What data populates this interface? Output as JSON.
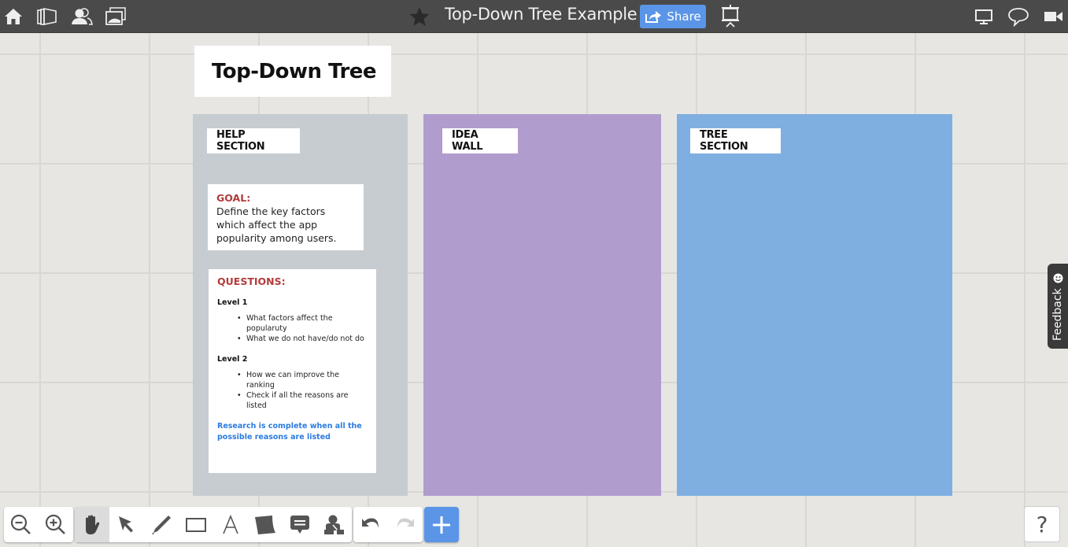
{
  "topbar": {
    "title": "Top-Down Tree Example",
    "share_label": "Share",
    "left_icons": [
      "home-icon",
      "boards-icon",
      "contacts-icon",
      "gallery-icon"
    ],
    "right_icons": [
      "screen-share-icon",
      "chat-icon",
      "video-icon"
    ],
    "favorite_icon": "star-icon",
    "present_icon": "presentation-icon"
  },
  "board": {
    "title": "Top-Down Tree",
    "sections": [
      {
        "label": "HELP SECTION",
        "color": "#c6ccd0"
      },
      {
        "label": "IDEA WALL",
        "color": "#b09ccd"
      },
      {
        "label": "TREE SECTION",
        "color": "#7fafe1"
      }
    ],
    "goal": {
      "heading": "GOAL:",
      "text": "Define the key factors which affect the app popularity among users."
    },
    "questions": {
      "heading": "QUESTIONS:",
      "levels": [
        {
          "title": "Level 1",
          "items": [
            "What factors affect the popularuty",
            "What we do not have/do not do"
          ]
        },
        {
          "title": "Level 2",
          "items": [
            "How we can improve the ranking",
            "Check if all the reasons are listed"
          ]
        }
      ],
      "note": "Research is complete when all the possible reasons are listed"
    }
  },
  "feedback": {
    "label": "Feedback"
  },
  "toolbar": {
    "zoom_tools": [
      "zoom-out",
      "zoom-in"
    ],
    "tools": [
      "hand",
      "select",
      "pen",
      "rectangle",
      "text",
      "sticky-note",
      "comment",
      "org-chart"
    ],
    "active_tool": "hand",
    "history": [
      "undo",
      "redo"
    ],
    "add_label": "+",
    "help_label": "?"
  },
  "colors": {
    "accent": "#5b95e7",
    "heading_red": "#b33b3b",
    "note_blue": "#2b7be0",
    "topbar": "#4a4a4a"
  }
}
